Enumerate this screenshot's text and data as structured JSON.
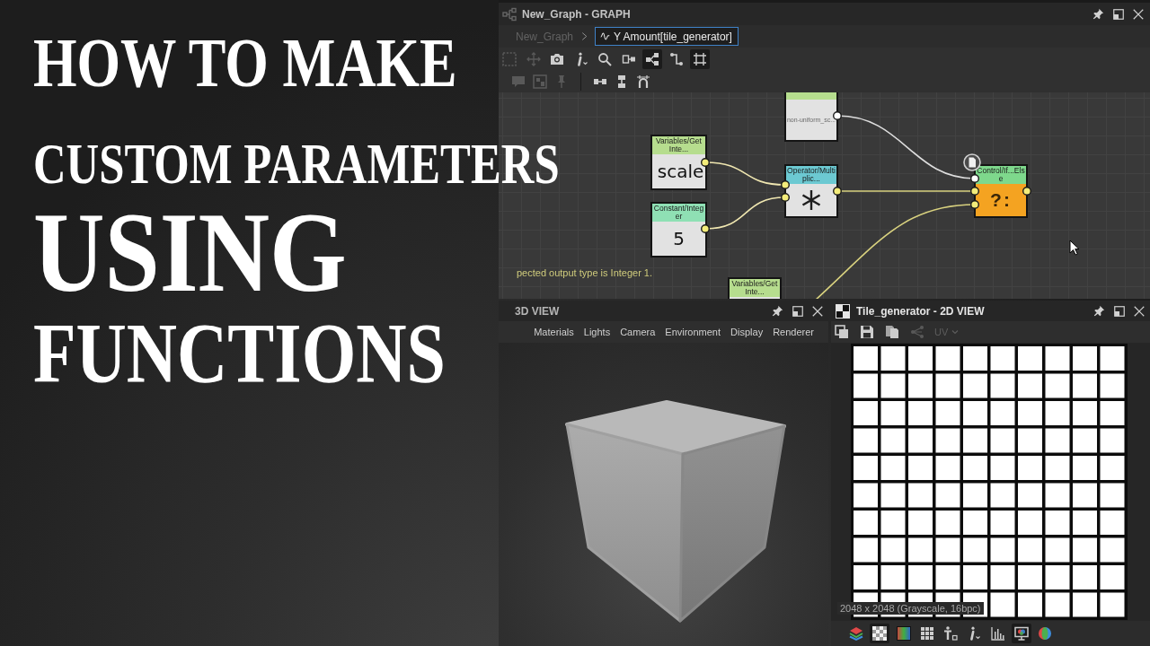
{
  "title_lines": [
    "HOW TO MAKE",
    "CUSTOM PARAMETERS",
    "USING",
    "FUNCTIONS"
  ],
  "graph_panel": {
    "title": "New_Graph - GRAPH",
    "breadcrumb": [
      {
        "label": "New_Graph",
        "kind": "graph",
        "selected": false
      },
      {
        "label": "Y Amount[tile_generator]",
        "kind": "function",
        "selected": true
      }
    ],
    "toolbar_rows": [
      [
        {
          "disabled": true,
          "on": false
        },
        {
          "disabled": true,
          "on": false
        },
        {
          "disabled": false,
          "on": false
        },
        {
          "disabled": false,
          "on": false
        },
        {
          "disabled": false,
          "on": false
        },
        {
          "disabled": false,
          "on": false
        },
        {
          "disabled": false,
          "on": true
        },
        {
          "disabled": false,
          "on": false
        },
        {
          "disabled": false,
          "on": true
        }
      ],
      [
        {
          "disabled": true,
          "on": false
        },
        {
          "disabled": true,
          "on": false
        },
        {
          "disabled": true,
          "on": false
        },
        {
          "disabled": false,
          "on": false
        },
        {
          "disabled": false,
          "on": false
        },
        {
          "disabled": false,
          "on": false
        }
      ]
    ],
    "nodes": [
      {
        "kind": "parameter",
        "color": "#b6dd8e",
        "value": "non-uniform_sc...",
        "commented": false
      },
      {
        "kind": "variable",
        "header": "Variables/Get Inte...",
        "color": "#b6dd8e",
        "value": "scale",
        "commented": false
      },
      {
        "kind": "constant",
        "header": "Constant/Integer",
        "color": "#8fe0b4",
        "value": "5",
        "commented": false
      },
      {
        "kind": "operator",
        "header": "Operator/Multiplic...",
        "color": "#6cc9d2",
        "commented": false
      },
      {
        "kind": "control",
        "header": "Control/If...Else",
        "color": "#7ed88c",
        "value": "?:",
        "commented": true
      },
      {
        "kind": "variable",
        "header": "Variables/Get Inte...",
        "color": "#b6dd8e",
        "commented": false
      }
    ],
    "message": "pected output type is Integer 1."
  },
  "view_3d": {
    "title": "3D VIEW",
    "menu": [
      "Materials",
      "Lights",
      "Camera",
      "Environment",
      "Display",
      "Renderer"
    ]
  },
  "view_2d": {
    "title": "Tile_generator - 2D VIEW",
    "toolbar": [
      {
        "kind": "button",
        "disabled": false
      },
      {
        "kind": "button",
        "disabled": false
      },
      {
        "kind": "button",
        "disabled": false
      },
      {
        "kind": "button",
        "disabled": true
      },
      {
        "kind": "dropdown",
        "label": "UV",
        "disabled": true
      }
    ],
    "info": "2048 x 2048 (Grayscale, 16bpc)",
    "bottom_toolbar": [
      {
        "on": false
      },
      {
        "on": true
      },
      {
        "on": false
      },
      {
        "on": false
      },
      {
        "on": false
      },
      {
        "on": false
      },
      {
        "on": false
      },
      {
        "on": true
      },
      {
        "on": false
      }
    ]
  }
}
